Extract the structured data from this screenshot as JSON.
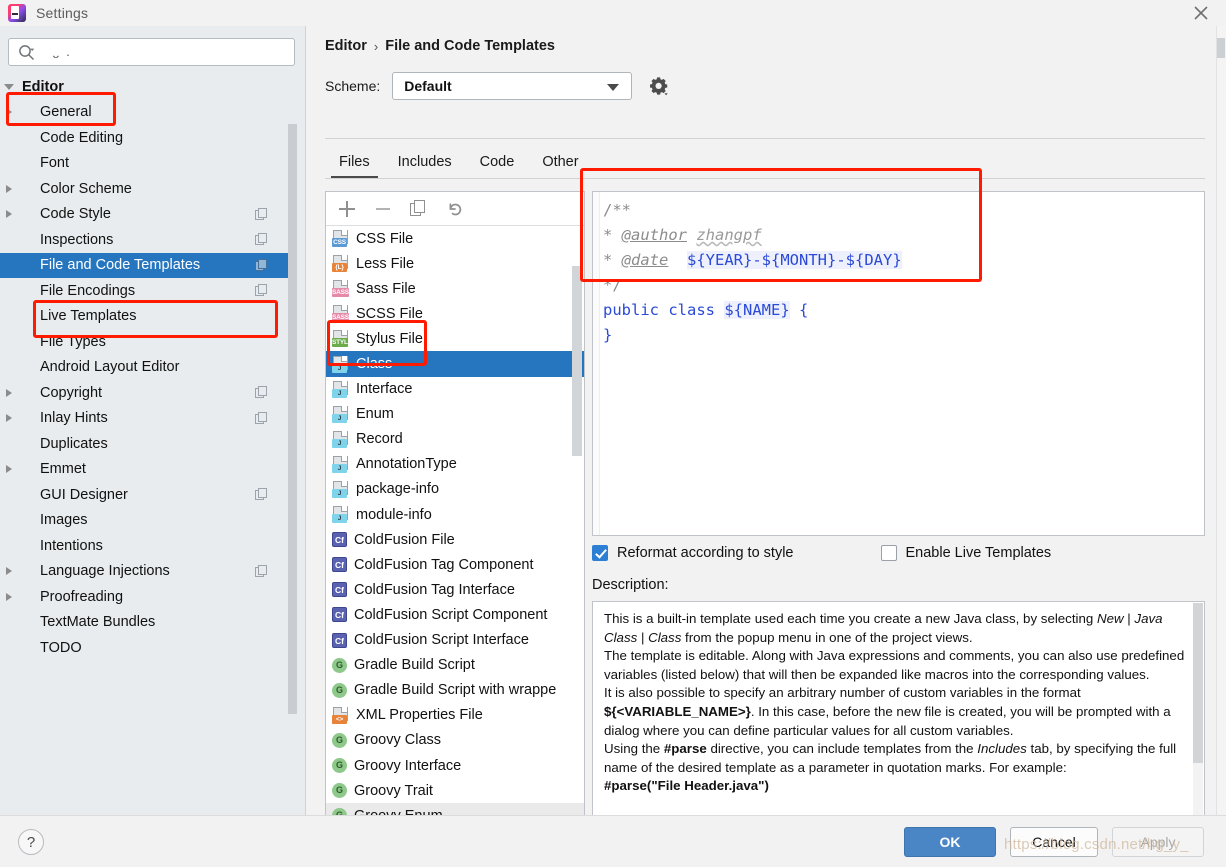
{
  "window": {
    "title": "Settings",
    "logo_icon": "intellij-idea-logo",
    "close_icon": "close-icon"
  },
  "sidebar": {
    "search": {
      "placeholder": "",
      "value": "",
      "icon": "search-icon"
    },
    "cut_item_above": "",
    "items": [
      {
        "label": "Editor",
        "indent": 0,
        "arrow": "open",
        "selected": false,
        "bold": true,
        "copy": false
      },
      {
        "label": "General",
        "indent": 1,
        "arrow": "collapsed",
        "selected": false,
        "bold": false,
        "copy": false
      },
      {
        "label": "Code Editing",
        "indent": 1,
        "arrow": "none",
        "selected": false,
        "bold": false,
        "copy": false
      },
      {
        "label": "Font",
        "indent": 1,
        "arrow": "none",
        "selected": false,
        "bold": false,
        "copy": false
      },
      {
        "label": "Color Scheme",
        "indent": 1,
        "arrow": "collapsed",
        "selected": false,
        "bold": false,
        "copy": false
      },
      {
        "label": "Code Style",
        "indent": 1,
        "arrow": "collapsed",
        "selected": false,
        "bold": false,
        "copy": true
      },
      {
        "label": "Inspections",
        "indent": 1,
        "arrow": "none",
        "selected": false,
        "bold": false,
        "copy": true
      },
      {
        "label": "File and Code Templates",
        "indent": 1,
        "arrow": "none",
        "selected": true,
        "bold": false,
        "copy": true
      },
      {
        "label": "File Encodings",
        "indent": 1,
        "arrow": "none",
        "selected": false,
        "bold": false,
        "copy": true
      },
      {
        "label": "Live Templates",
        "indent": 1,
        "arrow": "none",
        "selected": false,
        "bold": false,
        "copy": false
      },
      {
        "label": "File Types",
        "indent": 1,
        "arrow": "none",
        "selected": false,
        "bold": false,
        "copy": false
      },
      {
        "label": "Android Layout Editor",
        "indent": 1,
        "arrow": "none",
        "selected": false,
        "bold": false,
        "copy": false
      },
      {
        "label": "Copyright",
        "indent": 1,
        "arrow": "collapsed",
        "selected": false,
        "bold": false,
        "copy": true
      },
      {
        "label": "Inlay Hints",
        "indent": 1,
        "arrow": "collapsed",
        "selected": false,
        "bold": false,
        "copy": true
      },
      {
        "label": "Duplicates",
        "indent": 1,
        "arrow": "none",
        "selected": false,
        "bold": false,
        "copy": false
      },
      {
        "label": "Emmet",
        "indent": 1,
        "arrow": "collapsed",
        "selected": false,
        "bold": false,
        "copy": false
      },
      {
        "label": "GUI Designer",
        "indent": 1,
        "arrow": "none",
        "selected": false,
        "bold": false,
        "copy": true
      },
      {
        "label": "Images",
        "indent": 1,
        "arrow": "none",
        "selected": false,
        "bold": false,
        "copy": false
      },
      {
        "label": "Intentions",
        "indent": 1,
        "arrow": "none",
        "selected": false,
        "bold": false,
        "copy": false
      },
      {
        "label": "Language Injections",
        "indent": 1,
        "arrow": "collapsed",
        "selected": false,
        "bold": false,
        "copy": true
      },
      {
        "label": "Proofreading",
        "indent": 1,
        "arrow": "collapsed",
        "selected": false,
        "bold": false,
        "copy": false
      },
      {
        "label": "TextMate Bundles",
        "indent": 1,
        "arrow": "none",
        "selected": false,
        "bold": false,
        "copy": false
      },
      {
        "label": "TODO",
        "indent": 1,
        "arrow": "none",
        "selected": false,
        "bold": false,
        "copy": false
      }
    ]
  },
  "header": {
    "breadcrumb_root": "Editor",
    "breadcrumb_separator": "›",
    "breadcrumb_leaf": "File and Code Templates",
    "scheme_label": "Scheme:",
    "scheme_value": "Default",
    "scheme_chevron_icon": "chevron-down-icon",
    "gear_icon": "gear-icon"
  },
  "tabs": [
    {
      "label": "Files",
      "active": true
    },
    {
      "label": "Includes",
      "active": false
    },
    {
      "label": "Code",
      "active": false
    },
    {
      "label": "Other",
      "active": false
    }
  ],
  "list_toolbar": [
    {
      "name": "add-template-button",
      "icon": "plus-icon"
    },
    {
      "name": "remove-template-button",
      "icon": "minus-icon"
    },
    {
      "name": "copy-template-button",
      "icon": "copy-icon"
    },
    {
      "name": "reset-template-button",
      "icon": "undo-icon"
    }
  ],
  "template_list": [
    {
      "label": "CSS File",
      "icon": "css-file-icon",
      "kind": "css",
      "tag": "CSS",
      "selected": false,
      "hover": false
    },
    {
      "label": "Less File",
      "icon": "less-file-icon",
      "kind": "less",
      "tag": "{L}",
      "selected": false,
      "hover": false
    },
    {
      "label": "Sass File",
      "icon": "sass-file-icon",
      "kind": "sass",
      "tag": "SASS",
      "selected": false,
      "hover": false
    },
    {
      "label": "SCSS File",
      "icon": "scss-file-icon",
      "kind": "sass",
      "tag": "SASS",
      "selected": false,
      "hover": false
    },
    {
      "label": "Stylus File",
      "icon": "stylus-file-icon",
      "kind": "styl",
      "tag": "STYL",
      "selected": false,
      "hover": false
    },
    {
      "label": "Class",
      "icon": "java-class-icon",
      "kind": "java",
      "tag": "J",
      "selected": true,
      "hover": false
    },
    {
      "label": "Interface",
      "icon": "java-interface-icon",
      "kind": "java",
      "tag": "J",
      "selected": false,
      "hover": false
    },
    {
      "label": "Enum",
      "icon": "java-enum-icon",
      "kind": "java",
      "tag": "J",
      "selected": false,
      "hover": false
    },
    {
      "label": "Record",
      "icon": "java-record-icon",
      "kind": "java",
      "tag": "J",
      "selected": false,
      "hover": false
    },
    {
      "label": "AnnotationType",
      "icon": "java-annotation-icon",
      "kind": "java",
      "tag": "J",
      "selected": false,
      "hover": false
    },
    {
      "label": "package-info",
      "icon": "java-package-info-icon",
      "kind": "java",
      "tag": "J",
      "selected": false,
      "hover": false
    },
    {
      "label": "module-info",
      "icon": "java-module-info-icon",
      "kind": "java",
      "tag": "J",
      "selected": false,
      "hover": false
    },
    {
      "label": "ColdFusion File",
      "icon": "coldfusion-file-icon",
      "kind": "cf",
      "tag": "Cf",
      "selected": false,
      "hover": false
    },
    {
      "label": "ColdFusion Tag Component",
      "icon": "coldfusion-file-icon",
      "kind": "cf",
      "tag": "Cf",
      "selected": false,
      "hover": false
    },
    {
      "label": "ColdFusion Tag Interface",
      "icon": "coldfusion-file-icon",
      "kind": "cf",
      "tag": "Cf",
      "selected": false,
      "hover": false
    },
    {
      "label": "ColdFusion Script Component",
      "icon": "coldfusion-file-icon",
      "kind": "cf",
      "tag": "Cf",
      "selected": false,
      "hover": false
    },
    {
      "label": "ColdFusion Script Interface",
      "icon": "coldfusion-file-icon",
      "kind": "cf",
      "tag": "Cf",
      "selected": false,
      "hover": false
    },
    {
      "label": "Gradle Build Script",
      "icon": "gradle-groovy-icon",
      "kind": "groovy",
      "tag": "G",
      "selected": false,
      "hover": false
    },
    {
      "label": "Gradle Build Script with wrappe",
      "icon": "gradle-groovy-icon",
      "kind": "groovy",
      "tag": "G",
      "selected": false,
      "hover": false
    },
    {
      "label": "XML Properties File",
      "icon": "xml-properties-file-icon",
      "kind": "xml",
      "tag": "<>",
      "selected": false,
      "hover": false
    },
    {
      "label": "Groovy Class",
      "icon": "groovy-class-icon",
      "kind": "groovy",
      "tag": "G",
      "selected": false,
      "hover": false
    },
    {
      "label": "Groovy Interface",
      "icon": "groovy-interface-icon",
      "kind": "groovy",
      "tag": "G",
      "selected": false,
      "hover": false
    },
    {
      "label": "Groovy Trait",
      "icon": "groovy-trait-icon",
      "kind": "groovy",
      "tag": "G",
      "selected": false,
      "hover": false
    },
    {
      "label": "Groovy Enum",
      "icon": "groovy-enum-icon",
      "kind": "groovy",
      "tag": "G",
      "selected": false,
      "hover": true
    }
  ],
  "editor": {
    "lines": [
      "/**",
      " * @author zhangpf",
      " * @date  ${YEAR}-${MONTH}-${DAY}",
      " */",
      "public class ${NAME} {",
      "}"
    ],
    "author_value": "zhangpf",
    "date_expression": "${YEAR}-${MONTH}-${DAY}",
    "class_name_variable": "${NAME}"
  },
  "options": {
    "reformat": {
      "label": "Reformat according to style",
      "checked": true
    },
    "live_templates": {
      "label": "Enable Live Templates",
      "checked": false
    }
  },
  "description": {
    "label": "Description:",
    "paragraphs": [
      "This is a built-in template used each time you create a new Java class, by selecting New | Java Class | Class from the popup menu in one of the project views.",
      "The template is editable. Along with Java expressions and comments, you can also use predefined variables (listed below) that will then be expanded like macros into the corresponding values.",
      "It is also possible to specify an arbitrary number of custom variables in the format ${<VARIABLE_NAME>}. In this case, before the new file is created, you will be prompted with a dialog where you can define particular values for all custom variables.",
      "Using the #parse directive, you can include templates from the Includes tab, by specifying the full name of the desired template as a parameter in quotation marks. For example:",
      "#parse(\"File Header.java\")"
    ]
  },
  "footer": {
    "help_label": "?",
    "ok_label": "OK",
    "cancel_label": "Cancel",
    "apply_label": "Apply",
    "watermark": "https://blog.csdn.net/hg_y_"
  },
  "colors": {
    "selection_blue": "#2675bf",
    "primary_button": "#4a86c5",
    "annotation_red": "#ff1a00",
    "sidebar_bg": "#e8ecef",
    "code_keyword": "#2a4ad7",
    "code_comment": "#8c8c8c"
  }
}
